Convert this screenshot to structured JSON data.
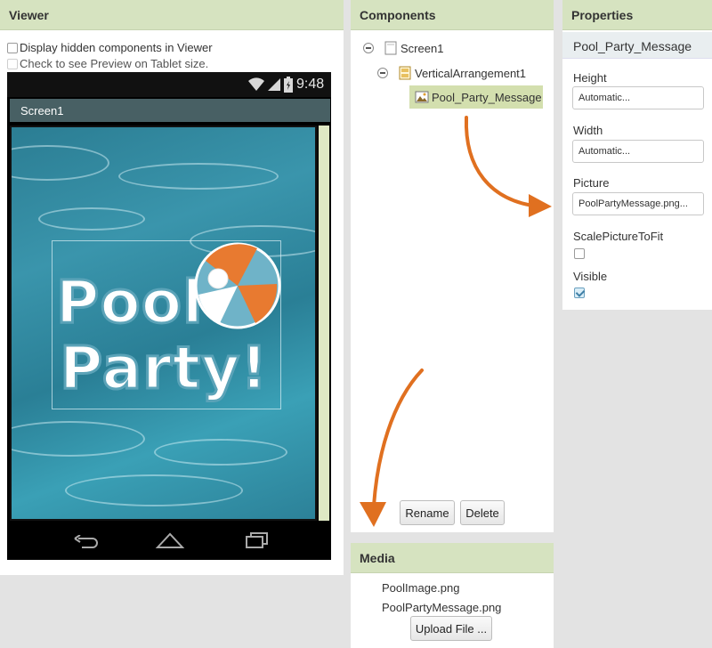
{
  "viewer": {
    "title": "Viewer",
    "display_hidden_label": "Display hidden components in Viewer",
    "display_hidden_checked": false,
    "tablet_preview_label": "Check to see Preview on Tablet size.",
    "tablet_preview_checked": false,
    "phone": {
      "time": "9:48",
      "screen_title": "Screen1",
      "image_text_line1": "Pool",
      "image_text_line2": "Party!"
    }
  },
  "components": {
    "title": "Components",
    "tree": [
      {
        "label": "Screen1",
        "level": 0
      },
      {
        "label": "VerticalArrangement1",
        "level": 1
      },
      {
        "label": "Pool_Party_Message",
        "level": 2,
        "selected": true
      }
    ],
    "rename_label": "Rename",
    "delete_label": "Delete"
  },
  "media": {
    "title": "Media",
    "files": [
      "PoolImage.png",
      "PoolPartyMessage.png"
    ],
    "upload_label": "Upload File ..."
  },
  "properties": {
    "title": "Properties",
    "component_name": "Pool_Party_Message",
    "height_label": "Height",
    "height_value": "Automatic...",
    "width_label": "Width",
    "width_value": "Automatic...",
    "picture_label": "Picture",
    "picture_value": "PoolPartyMessage.png...",
    "scale_label": "ScalePictureToFit",
    "scale_checked": false,
    "visible_label": "Visible",
    "visible_checked": true
  },
  "colors": {
    "header_bg": "#d6e3c0",
    "selected_bg": "#d3dfae",
    "arrow": "#e07020",
    "water": "#2f88a0"
  },
  "icons": [
    "wifi-icon",
    "signal-icon",
    "battery-icon",
    "back-icon",
    "home-icon",
    "recents-icon",
    "screen-icon",
    "arrangement-icon",
    "image-icon"
  ]
}
